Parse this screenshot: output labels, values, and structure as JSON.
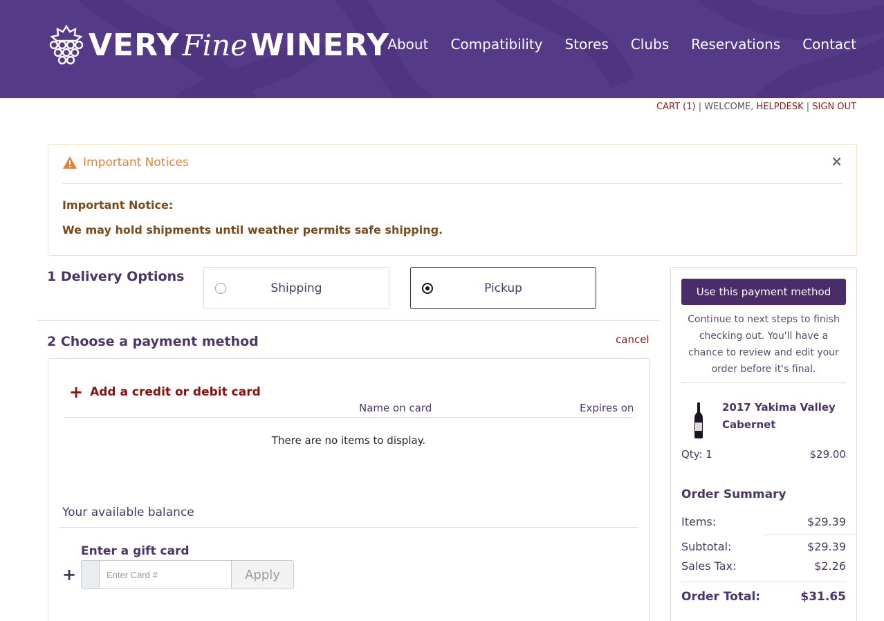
{
  "header": {
    "logo": {
      "very": "VERY",
      "fine": "Fine",
      "winery": "WINERY"
    },
    "nav": [
      "About",
      "Compatibility",
      "Stores",
      "Clubs",
      "Reservations",
      "Contact"
    ]
  },
  "util": {
    "cart": "CART (1)",
    "sep1": " | ",
    "welcome_prefix": "WELCOME, ",
    "user": "HELPDESK",
    "sep2": " | ",
    "signout": "SIGN OUT"
  },
  "notice": {
    "title": "Important Notices",
    "close": "×",
    "heading": "Important Notice:",
    "message": "We may hold shipments until weather permits safe shipping."
  },
  "delivery": {
    "number": "1",
    "title": "Delivery Options",
    "options": [
      {
        "label": "Shipping",
        "selected": false
      },
      {
        "label": "Pickup",
        "selected": true
      }
    ]
  },
  "payment": {
    "number": "2",
    "title": "Choose a payment method",
    "cancel": "cancel",
    "add_card": "Add a credit or debit card",
    "col_name": "Name on card",
    "col_expires": "Expires on",
    "empty": "There are no items to display.",
    "balance": "Your available balance",
    "gift_label": "Enter a gift card",
    "gift_placeholder": "Enter Card #",
    "apply": "Apply"
  },
  "summary": {
    "button": "Use this payment method",
    "continue_text": "Continue to next steps to finish checking out. You'll have a chance to review and edit your order before it's final.",
    "product": {
      "name": "2017 Yakima Valley Cabernet",
      "qty": "Qty: 1",
      "price": "$29.00"
    },
    "order_summary_title": "Order Summary",
    "items_label": "Items:",
    "items_value": "$29.39",
    "subtotal_label": "Subtotal:",
    "subtotal_value": "$29.39",
    "tax_label": "Sales Tax:",
    "tax_value": "$2.26",
    "total_label": "Order Total:",
    "total_value": "$31.65"
  },
  "colors": {
    "header_bg": "#553a87",
    "accent": "#4a2c68",
    "link_red": "#8a1a1a",
    "warning": "#e9812f"
  }
}
